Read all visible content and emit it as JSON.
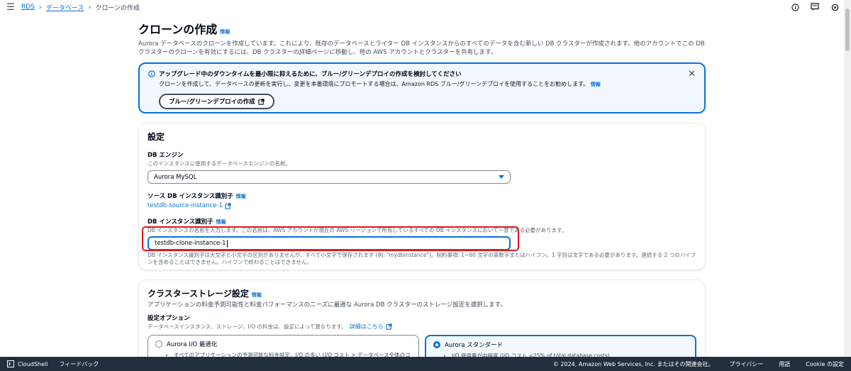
{
  "breadcrumb": {
    "rds": "RDS",
    "databases": "データベース",
    "current": "クローンの作成"
  },
  "page": {
    "title": "クローンの作成",
    "info_label": "情報",
    "description": "Aurora データベースのクローンを作成しています。これにより、既存のデータベースとライター DB インスタンスからのすべてのデータを含む新しい DB クラスターが作成されます。他のアカウントでこの DB クラスターのクローンを有効にするには、DB クラスターの詳細ページに移動し、他の AWS アカウントとクラスターを共有します。"
  },
  "alert": {
    "title": "アップグレード中のダウンタイムを最小限に抑えるために、ブルー/グリーンデプロイの作成を検討してください",
    "text": "クローンを作成して、データベースの更新を実行し、変更を本番環境にプロモートする場合は、Amazon RDS ブルー/グリーンデプロイを使用することをお勧めします。",
    "info_label": "情報",
    "button_label": "ブルー/グリーンデプロイの作成"
  },
  "settings": {
    "title": "設定",
    "engine_label": "DB エンジン",
    "engine_desc": "このインスタンスに使用するデータベースエンジンの名前。",
    "engine_value": "Aurora MySQL",
    "source_label": "ソース DB インスタンス識別子",
    "source_info": "情報",
    "source_value": "testdb-source-instance-1",
    "identifier_label": "DB インスタンス識別子",
    "identifier_info": "情報",
    "identifier_desc": "DB インスタンスの名前を入力します。この名前は、AWS アカウントが現在の AWS リージョンで所有しているすべての DB インスタンスにおいて一意である必要があります。",
    "identifier_value": "testdb-clone-instance-1",
    "identifier_constraint": "DB インスタンス識別子は大文字と小文字の区別がありませんが、すべて小文字で保存されます (例: \"mydbinstance\")。制約事項: 1~60 文字の英数字またはハイフン。1 字目は文字である必要があります。連続する 2 つのハイフンを含めることはできません。ハイフンで終わることはできません。"
  },
  "storage": {
    "title": "クラスターストレージ設定",
    "info_label": "情報",
    "description": "アプリケーションの料金予測可能性と料金パフォーマンスのニーズに最適な Aurora DB クラスターのストレージ設定を選択します。",
    "options_label": "設定オプション",
    "options_desc": "データベースインスタンス、ストレージ、I/O の料金は、設定によって異なります。",
    "details_link": "詳細はこちら",
    "option1_label": "Aurora I/O 最適化",
    "option1_desc": "すべてのアプリケーションの予測可能な料金設定。I/O の多い (I/O コスト > データベース全体のコ",
    "option2_label": "Aurora スタンダード",
    "option2_desc": "I/O 使用量が中程度 (I/O コスト <25% of total database costs)."
  },
  "footer": {
    "cloudshell": "CloudShell",
    "feedback": "フィードバック",
    "copyright": "© 2024, Amazon Web Services, Inc. またはその関連会社。",
    "privacy": "プライバシー",
    "terms": "用語",
    "cookie": "Cookie の設定"
  },
  "colors": {
    "accent": "#0972d3",
    "footer_bg": "#232f3e",
    "highlight": "#e0161f"
  }
}
